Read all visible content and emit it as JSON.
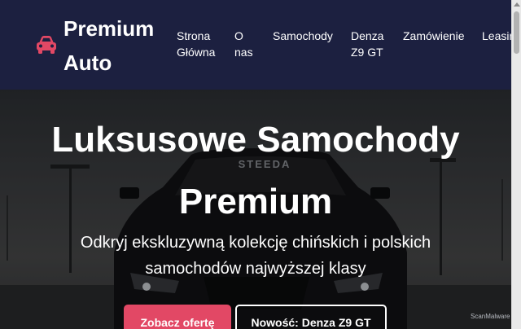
{
  "brand": {
    "name": "Premium Auto",
    "icon": "car-icon",
    "icon_color": "#e24865"
  },
  "nav": {
    "items": [
      {
        "label": "Strona\nGłówna"
      },
      {
        "label": "O\nnas"
      },
      {
        "label": "Samochody"
      },
      {
        "label": "Denza\nZ9 GT"
      },
      {
        "label": "Zamówienie"
      },
      {
        "label": "Leasing"
      }
    ]
  },
  "hero": {
    "title_line1": "Luksusowe Samochody",
    "title_line2": "Premium",
    "subtitle": "Odkryj ekskluzywną kolekcję chińskich i polskich samochodów najwyższej klasy",
    "primary_button": "Zobacz ofertę",
    "secondary_button": "Nowość: Denza Z9 GT",
    "windshield_text": "STEEDA",
    "watermark": "ScanMalware"
  },
  "colors": {
    "header_bg": "#1c2040",
    "accent": "#e24865"
  }
}
